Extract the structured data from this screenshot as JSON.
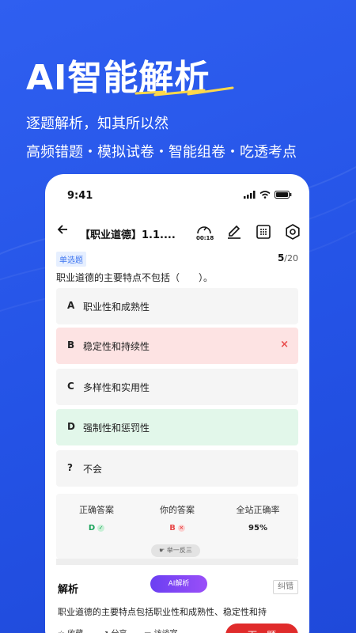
{
  "hero": {
    "title": "AI智能解析",
    "subtitle1": "逐题解析，知其所以然",
    "subtitle2": "高频错题・模拟试卷・智能组卷・吃透考点"
  },
  "status_bar": {
    "time": "9:41"
  },
  "nav": {
    "title": "【职业道德】1.1....",
    "timer": "00:18",
    "icons": [
      "back-arrow-icon",
      "timer-icon",
      "edit-icon",
      "answer-card-icon",
      "settings-icon"
    ]
  },
  "question": {
    "type": "单选题",
    "current": "5",
    "total": "/20",
    "text": "职业道德的主要特点不包括（　　）。",
    "options": [
      {
        "letter": "A",
        "text": "职业性和成熟性",
        "state": "normal"
      },
      {
        "letter": "B",
        "text": "稳定性和持续性",
        "state": "wrong",
        "mark": "×"
      },
      {
        "letter": "C",
        "text": "多样性和实用性",
        "state": "normal"
      },
      {
        "letter": "D",
        "text": "强制性和惩罚性",
        "state": "correct"
      },
      {
        "letter": "?",
        "text": "不会",
        "state": "normal"
      }
    ]
  },
  "stats": {
    "correct_label": "正确答案",
    "correct_value": "D",
    "yours_label": "你的答案",
    "yours_value": "B",
    "rate_label": "全站正确率",
    "rate_value": "95%"
  },
  "expand_pill": "☛ 举一反三",
  "analysis": {
    "title": "解析",
    "ai_button": "AI解析",
    "correct_button": "纠错",
    "text": "职业道德的主要特点包括职业性和成熟性、稳定性和持"
  },
  "bottom_bar": {
    "favorite": "☆ 收藏",
    "share": "↗ 分享",
    "lecture": "▭ 访谈室",
    "next": "下一题"
  },
  "colors": {
    "background": "#2453e6",
    "wrong_bg": "#fde3e3",
    "correct_bg": "#e2f7ea",
    "accent_red": "#e02b2b",
    "ai_purple": "#7b45f4"
  }
}
